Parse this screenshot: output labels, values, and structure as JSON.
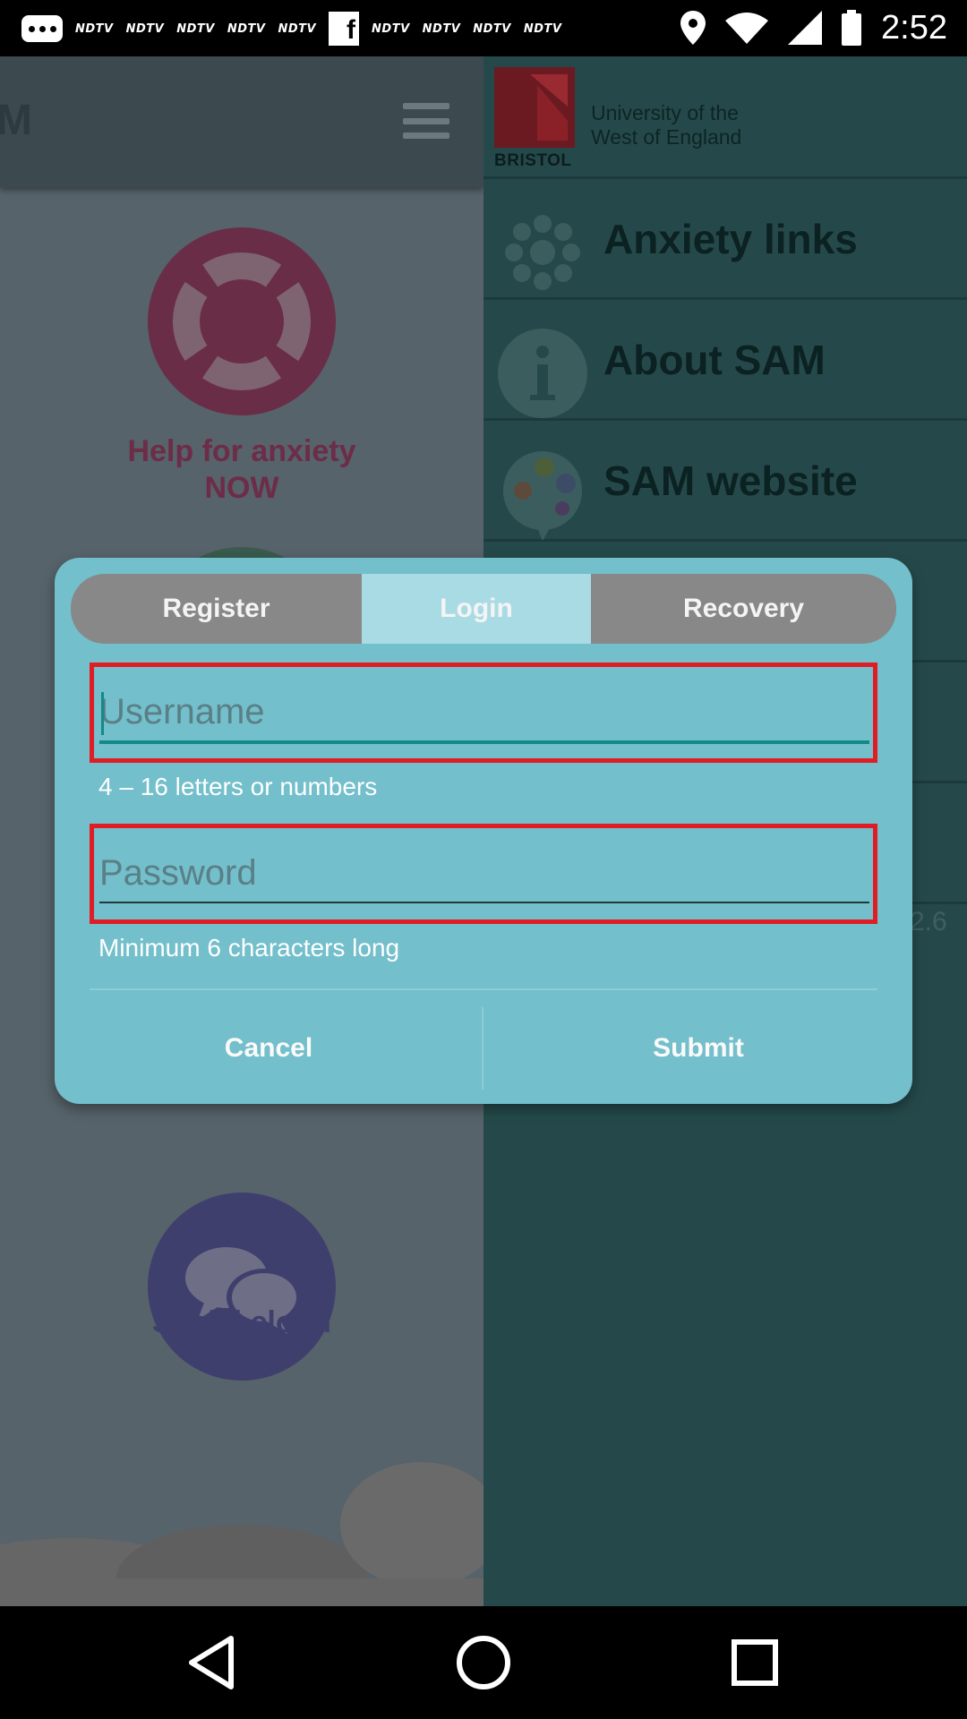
{
  "status_bar": {
    "notification_labels": [
      "NDTV",
      "NDTV",
      "NDTV",
      "NDTV",
      "NDTV",
      "NDTV",
      "NDTV",
      "NDTV",
      "NDTV"
    ],
    "facebook_glyph": "f",
    "time": "2:52",
    "icons": [
      "more-icon",
      "facebook-icon",
      "location-icon",
      "wifi-icon",
      "signal-icon",
      "battery-icon"
    ]
  },
  "main": {
    "title": "M",
    "tiles": {
      "help_label_line1": "Help for anxiety",
      "help_label_line2": "NOW",
      "social_label": "Social cloud"
    },
    "colors": {
      "help": "#6a2d47",
      "social": "#3f3f6e"
    }
  },
  "drawer": {
    "logo_brand": "UWE",
    "logo_city": "BRISTOL",
    "university_line1": "University of the",
    "university_line2": "West of England",
    "items": [
      {
        "label": "Anxiety links",
        "icon": "flower-icon"
      },
      {
        "label": "About SAM",
        "icon": "info-icon"
      },
      {
        "label": "SAM website",
        "icon": "palette-chat-icon"
      }
    ],
    "version_fragment": "2.6"
  },
  "dialog": {
    "tabs": [
      {
        "label": "Register",
        "selected": false
      },
      {
        "label": "Login",
        "selected": true
      },
      {
        "label": "Recovery",
        "selected": false
      }
    ],
    "username": {
      "placeholder": "Username",
      "value": "",
      "hint": "4 – 16 letters or numbers"
    },
    "password": {
      "placeholder": "Password",
      "value": "",
      "hint": "Minimum 6 characters long"
    },
    "buttons": {
      "cancel": "Cancel",
      "submit": "Submit"
    },
    "colors": {
      "dialog_bg": "#73bfcb",
      "tab_selected": "#a9dbe4",
      "error_border": "#e01c24"
    }
  },
  "nav_bar": {
    "icons": [
      "back-icon",
      "home-icon",
      "recent-apps-icon"
    ]
  }
}
